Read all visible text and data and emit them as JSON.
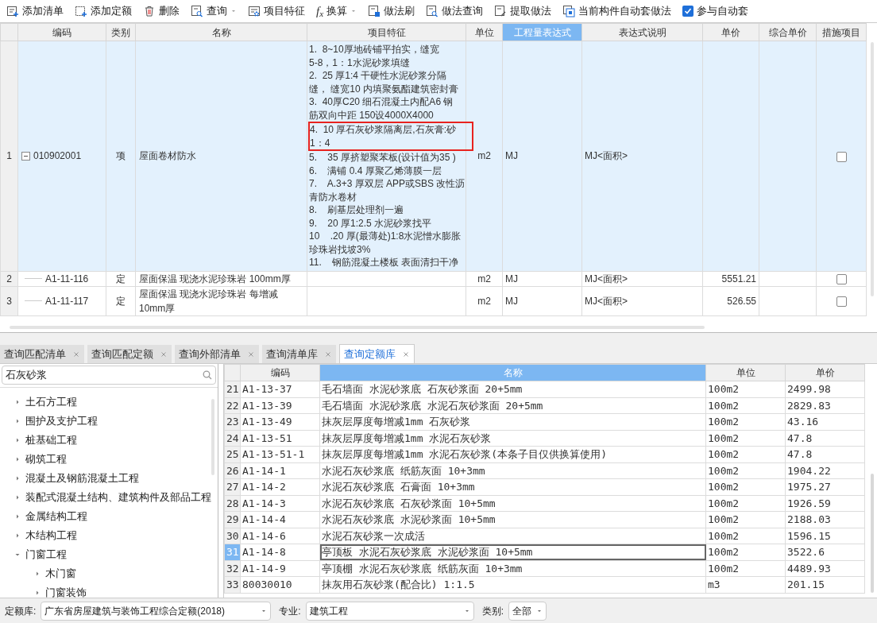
{
  "toolbar": {
    "items": [
      {
        "label": "添加清单",
        "dropdown": false
      },
      {
        "label": "添加定额",
        "dropdown": false
      },
      {
        "label": "删除",
        "dropdown": false
      },
      {
        "label": "查询",
        "dropdown": true
      },
      {
        "label": "项目特征",
        "dropdown": false
      },
      {
        "label": "换算",
        "dropdown": true,
        "icon_glyph": "f$_{x}$"
      },
      {
        "label": "做法刷",
        "dropdown": false
      },
      {
        "label": "做法查询",
        "dropdown": false
      },
      {
        "label": "提取做法",
        "dropdown": false
      },
      {
        "label": "当前构件自动套做法",
        "dropdown": false
      }
    ],
    "checkbox": {
      "label": "参与自动套",
      "checked": true
    }
  },
  "top_table": {
    "columns": [
      {
        "label": "编码",
        "selected": false
      },
      {
        "label": "类别",
        "selected": false
      },
      {
        "label": "名称",
        "selected": false
      },
      {
        "label": "项目特征",
        "selected": false
      },
      {
        "label": "单位",
        "selected": false
      },
      {
        "label": "工程量表达式",
        "selected": true
      },
      {
        "label": "表达式说明",
        "selected": false
      },
      {
        "label": "单价",
        "selected": false
      },
      {
        "label": "综合单价",
        "selected": false
      },
      {
        "label": "措施项目",
        "selected": false
      }
    ],
    "rows": [
      {
        "number": "1",
        "selected": true,
        "expanded": true,
        "code": "010902001",
        "kind": "项",
        "name": "屋面卷材防水",
        "features": [
          {
            "highlighted": false,
            "lines": [
              "1.  8~10厚地砖铺平拍实，缝宽",
              "5-8，1：1水泥砂浆填缝"
            ]
          },
          {
            "highlighted": false,
            "lines": [
              "2.  25 厚1:4 干硬性水泥砂浆分隔",
              "缝， 缝宽10 内填聚氨酯建筑密封膏"
            ]
          },
          {
            "highlighted": false,
            "lines": [
              "3.  40厚C20 细石混凝土内配A6 钢",
              "筋双向中距 150设4000X4000"
            ]
          },
          {
            "highlighted": true,
            "lines": [
              "4.  10 厚石灰砂浆隔离层,石灰膏:砂",
              "1：4"
            ]
          },
          {
            "highlighted": false,
            "lines": [
              "5.    35 厚挤塑聚苯板(设计值为35 )"
            ]
          },
          {
            "highlighted": false,
            "lines": [
              "6.    满铺 0.4 厚聚乙烯薄膜一层"
            ]
          },
          {
            "highlighted": false,
            "lines": [
              "7.    A.3+3 厚双层 APP或SBS 改性沥",
              "青防水卷材"
            ]
          },
          {
            "highlighted": false,
            "lines": [
              "8.    刷基层处理剂一遍"
            ]
          },
          {
            "highlighted": false,
            "lines": [
              "9.    20 厚1:2.5 水泥砂浆找平"
            ]
          },
          {
            "highlighted": false,
            "lines": [
              "10    .20 厚(最薄处)1:8水泥憎水膨胀",
              "珍珠岩找坡3%"
            ]
          },
          {
            "highlighted": false,
            "lines": [
              "11.    钢筋混凝土楼板 表面清扫干净"
            ]
          }
        ],
        "unit": "m2",
        "expression": "MJ",
        "expression_note": "MJ<面积>",
        "measure_checked": false
      },
      {
        "number": "2",
        "selected": false,
        "code": "A1-11-116",
        "kind": "定",
        "name": "屋面保温 现浇水泥珍珠岩 100mm厚",
        "unit": "m2",
        "expression": "MJ",
        "expression_note": "MJ<面积>",
        "price": "5551.21",
        "measure_checked": false
      },
      {
        "number": "3",
        "selected": false,
        "code": "A1-11-117",
        "kind": "定",
        "name": "屋面保温 现浇水泥珍珠岩 每增减 10mm厚",
        "unit": "m2",
        "expression": "MJ",
        "expression_note": "MJ<面积>",
        "price": "526.55",
        "measure_checked": false
      }
    ]
  },
  "tabs": [
    {
      "label": "查询匹配清单",
      "selected": false
    },
    {
      "label": "查询匹配定额",
      "selected": false
    },
    {
      "label": "查询外部清单",
      "selected": false
    },
    {
      "label": "查询清单库",
      "selected": false
    },
    {
      "label": "查询定额库",
      "selected": true
    }
  ],
  "search": {
    "value": "石灰砂浆"
  },
  "tree": [
    {
      "label": "土石方工程",
      "expanded": false
    },
    {
      "label": "围护及支护工程",
      "expanded": false
    },
    {
      "label": "桩基础工程",
      "expanded": false
    },
    {
      "label": "砌筑工程",
      "expanded": false
    },
    {
      "label": "混凝土及钢筋混凝土工程",
      "expanded": false
    },
    {
      "label": "装配式混凝土结构、建筑构件及部品工程",
      "expanded": false
    },
    {
      "label": "金属结构工程",
      "expanded": false
    },
    {
      "label": "木结构工程",
      "expanded": false
    },
    {
      "label": "门窗工程",
      "expanded": true,
      "children": [
        {
          "label": "木门窗",
          "expanded": false
        },
        {
          "label": "门窗装饰",
          "expanded": false
        }
      ]
    }
  ],
  "quota_table": {
    "columns": [
      {
        "label": "编码",
        "selected": false
      },
      {
        "label": "名称",
        "selected": true
      },
      {
        "label": "单位",
        "selected": false
      },
      {
        "label": "单价",
        "selected": false
      }
    ],
    "rows": [
      {
        "number": "21",
        "code": "A1-13-37",
        "name": "毛石墙面 水泥砂浆底 石灰砂浆面 20+5mm",
        "unit": "100m2",
        "price": "2499.98",
        "selected": false
      },
      {
        "number": "22",
        "code": "A1-13-39",
        "name": "毛石墙面 水泥砂浆底 水泥石灰砂浆面 20+5mm",
        "unit": "100m2",
        "price": "2829.83",
        "selected": false
      },
      {
        "number": "23",
        "code": "A1-13-49",
        "name": "抹灰层厚度每增减1mm 石灰砂浆",
        "unit": "100m2",
        "price": "43.16",
        "selected": false
      },
      {
        "number": "24",
        "code": "A1-13-51",
        "name": "抹灰层厚度每增减1mm 水泥石灰砂浆",
        "unit": "100m2",
        "price": "47.8",
        "selected": false
      },
      {
        "number": "25",
        "code": "A1-13-51-1",
        "name": "抹灰层厚度每增减1mm 水泥石灰砂浆(本条子目仅供换算使用)",
        "unit": "100m2",
        "price": "47.8",
        "selected": false
      },
      {
        "number": "26",
        "code": "A1-14-1",
        "name": "水泥石灰砂浆底 纸筋灰面 10+3mm",
        "unit": "100m2",
        "price": "1904.22",
        "selected": false
      },
      {
        "number": "27",
        "code": "A1-14-2",
        "name": "水泥石灰砂浆底 石膏面 10+3mm",
        "unit": "100m2",
        "price": "1975.27",
        "selected": false
      },
      {
        "number": "28",
        "code": "A1-14-3",
        "name": "水泥石灰砂浆底 石灰砂浆面 10+5mm",
        "unit": "100m2",
        "price": "1926.59",
        "selected": false
      },
      {
        "number": "29",
        "code": "A1-14-4",
        "name": "水泥石灰砂浆底 水泥砂浆面 10+5mm",
        "unit": "100m2",
        "price": "2188.03",
        "selected": false
      },
      {
        "number": "30",
        "code": "A1-14-6",
        "name": "水泥石灰砂浆一次成活",
        "unit": "100m2",
        "price": "1596.15",
        "selected": false
      },
      {
        "number": "31",
        "code": "A1-14-8",
        "name": "亭顶板 水泥石灰砂浆底 水泥砂浆面 10+5mm",
        "unit": "100m2",
        "price": "3522.6",
        "selected": true
      },
      {
        "number": "32",
        "code": "A1-14-9",
        "name": "亭顶棚 水泥石灰砂浆底 纸筋灰面 10+3mm",
        "unit": "100m2",
        "price": "4489.93",
        "selected": false
      },
      {
        "number": "33",
        "code": "80030010",
        "name": "抹灰用石灰砂浆(配合比) 1:1.5",
        "unit": "m3",
        "price": "201.15",
        "selected": false
      }
    ]
  },
  "footer": [
    {
      "label": "定额库:",
      "value": "广东省房屋建筑与装饰工程综合定额(2018)",
      "kind": "wide"
    },
    {
      "label": "专业:",
      "value": "建筑工程",
      "kind": "medium"
    },
    {
      "label": "类别:",
      "value": "全部",
      "kind": "small"
    }
  ]
}
